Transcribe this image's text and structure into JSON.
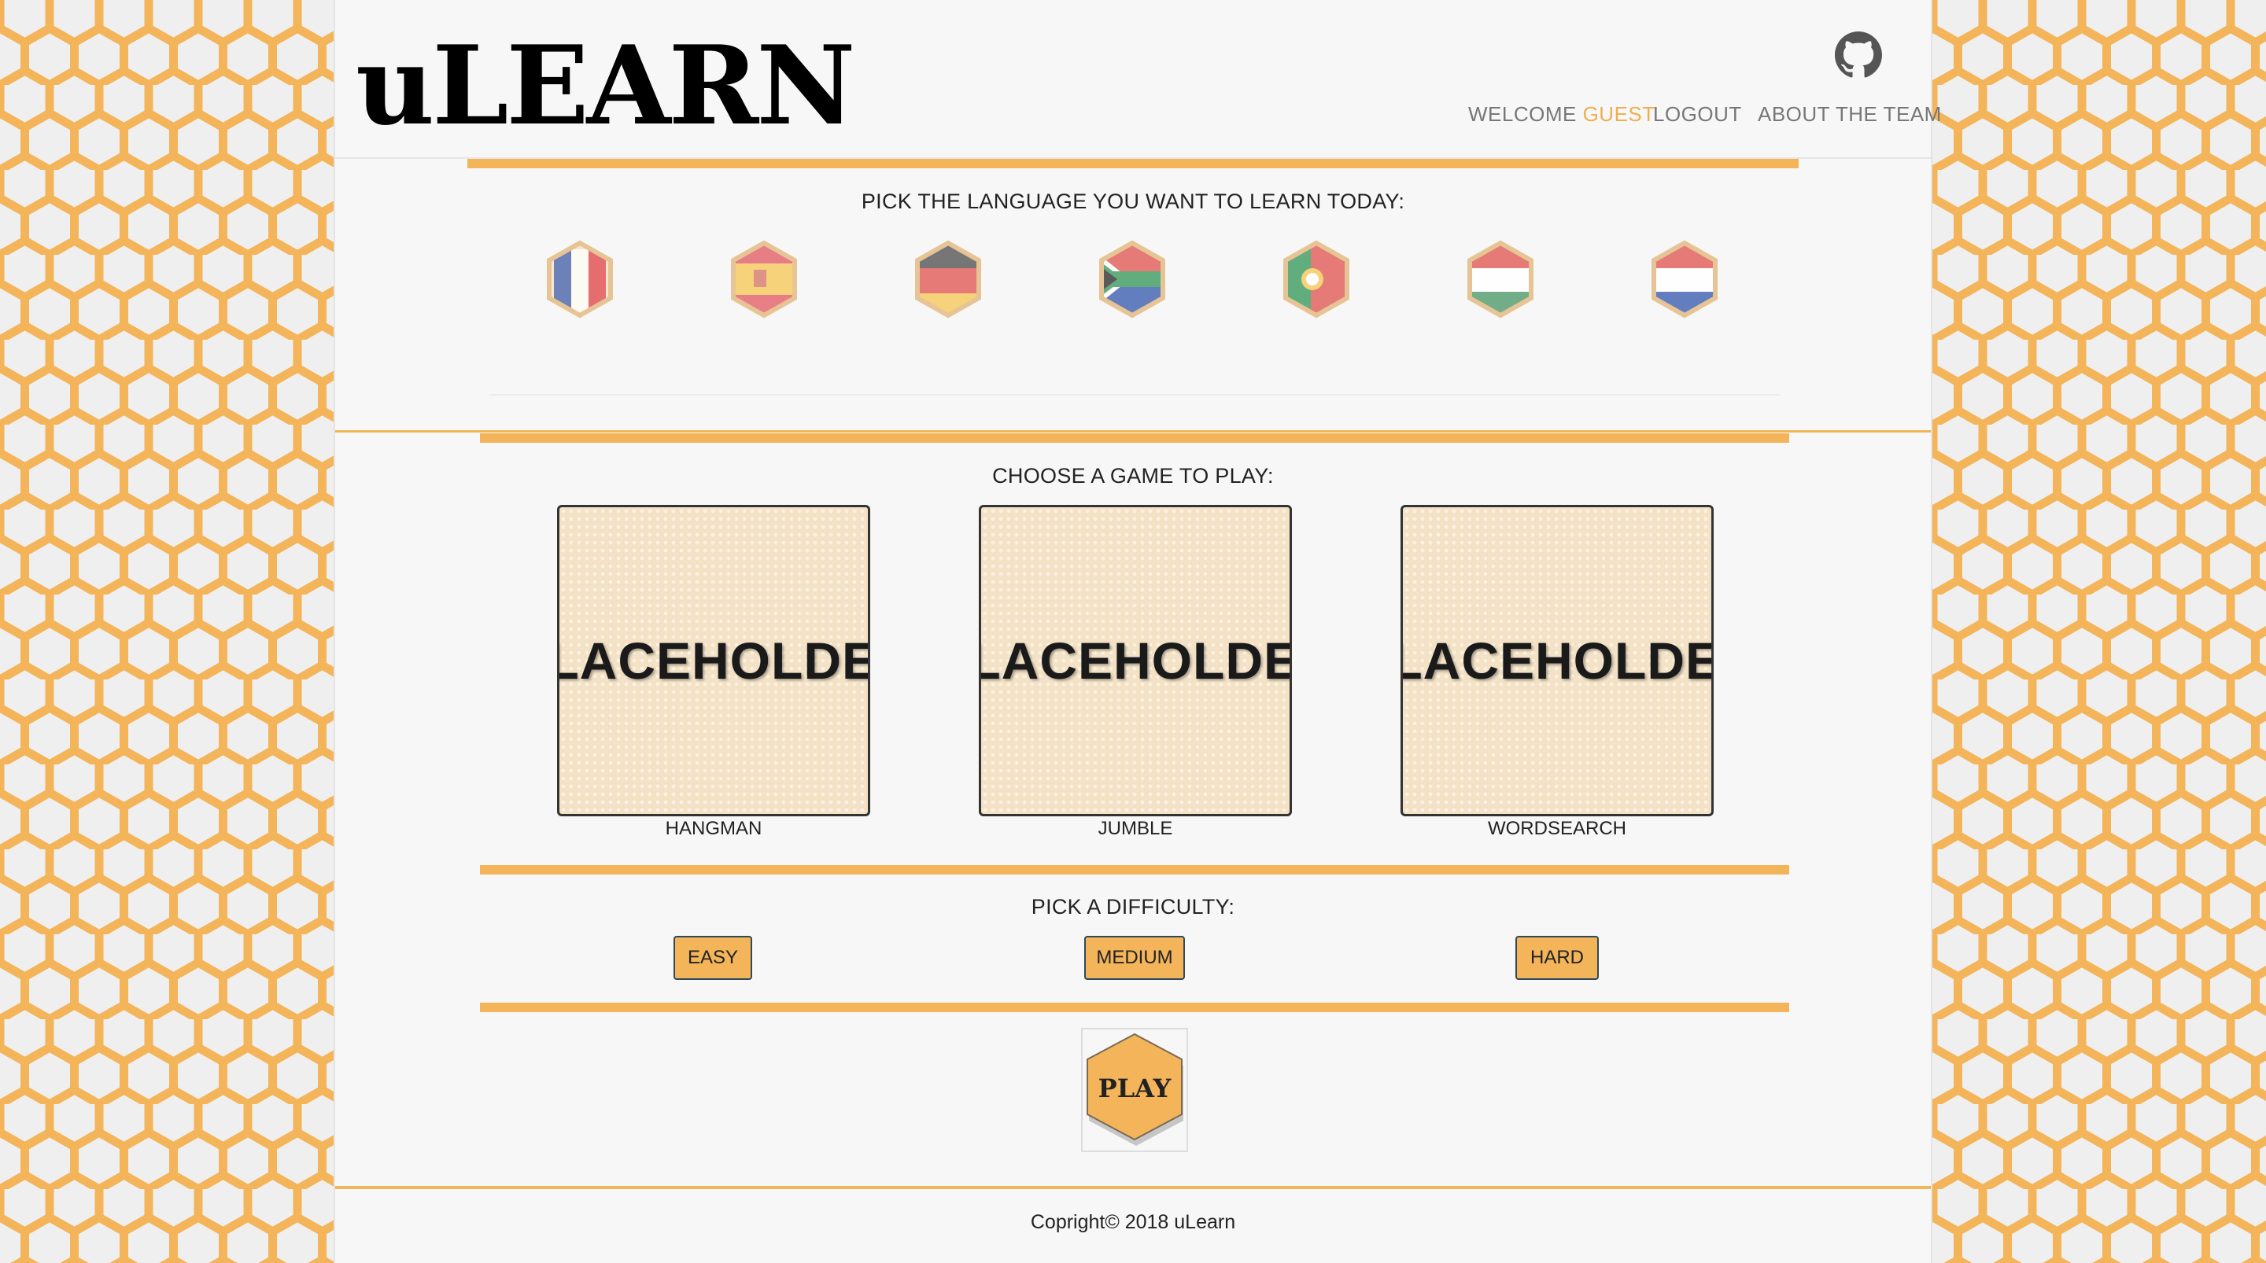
{
  "brand": {
    "name": "uLEARN",
    "accent_color": "#f3b45a",
    "background_pattern": "honeycomb"
  },
  "header": {
    "github_icon": "github-icon",
    "welcome_label": "WELCOME",
    "welcome_user": "GUEST",
    "logout_label": "LOGOUT",
    "about_label": "ABOUT THE TEAM"
  },
  "languages": {
    "title": "PICK THE LANGUAGE YOU WANT TO LEARN TODAY:",
    "flags": [
      {
        "name": "flag-france"
      },
      {
        "name": "flag-spain"
      },
      {
        "name": "flag-germany"
      },
      {
        "name": "flag-south-africa"
      },
      {
        "name": "flag-portugal"
      },
      {
        "name": "flag-hungary"
      },
      {
        "name": "flag-netherlands"
      }
    ]
  },
  "games": {
    "title": "CHOOSE A GAME TO PLAY:",
    "items": [
      {
        "image_text": "PLACEHOLDER",
        "label": "HANGMAN"
      },
      {
        "image_text": "PLACEHOLDER",
        "label": "JUMBLE"
      },
      {
        "image_text": "PLACEHOLDER",
        "label": "WORDSEARCH"
      }
    ]
  },
  "difficulty": {
    "title": "PICK A DIFFICULTY:",
    "options": [
      "EASY",
      "MEDIUM",
      "HARD"
    ]
  },
  "play": {
    "label": "PLAY"
  },
  "footer": {
    "copyright": "Copright© 2018 uLearn"
  }
}
